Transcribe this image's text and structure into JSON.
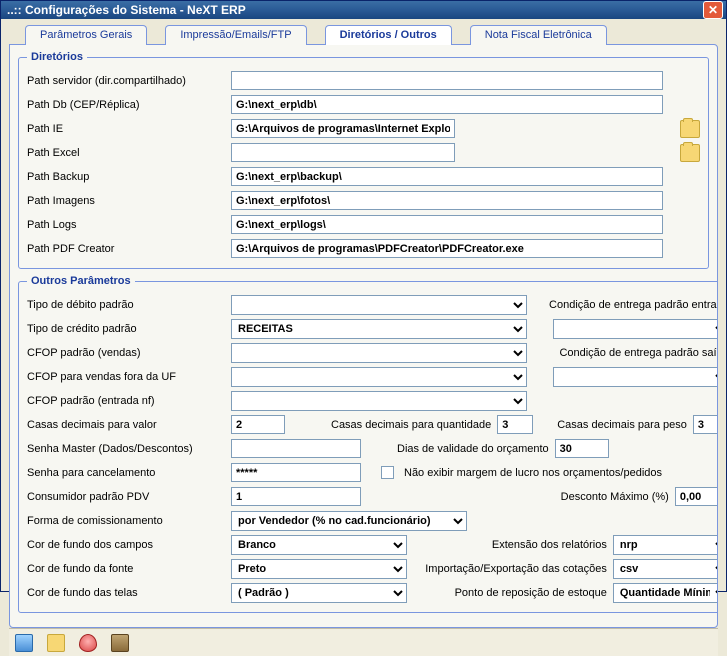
{
  "window": {
    "title": "..:: Configurações do Sistema - NeXT ERP"
  },
  "tabs": {
    "general": "Parâmetros Gerais",
    "print": "Impressão/Emails/FTP",
    "dirs": "Diretórios / Outros",
    "nfe": "Nota Fiscal Eletrônica"
  },
  "dir": {
    "legend": "Diretórios",
    "server_lbl": "Path servidor (dir.compartilhado)",
    "server_val": "",
    "db_lbl": "Path Db (CEP/Réplica)",
    "db_val": "G:\\next_erp\\db\\",
    "ie_lbl": "Path IE",
    "ie_val": "G:\\Arquivos de programas\\Internet Explorer\\iexplore.exe",
    "excel_lbl": "Path Excel",
    "excel_val": "",
    "backup_lbl": "Path Backup",
    "backup_val": "G:\\next_erp\\backup\\",
    "img_lbl": "Path Imagens",
    "img_val": "G:\\next_erp\\fotos\\",
    "logs_lbl": "Path Logs",
    "logs_val": "G:\\next_erp\\logs\\",
    "pdf_lbl": "Path PDF Creator",
    "pdf_val": "G:\\Arquivos de programas\\PDFCreator\\PDFCreator.exe"
  },
  "op": {
    "legend": "Outros Parâmetros",
    "tipo_deb_lbl": "Tipo de débito padrão",
    "tipo_cred_lbl": "Tipo de crédito padrão",
    "tipo_cred_val": "RECEITAS",
    "cfop_vendas_lbl": "CFOP padrão (vendas)",
    "cfop_fora_lbl": "CFOP para vendas fora da UF",
    "cfop_entrada_lbl": "CFOP padrão (entrada nf)",
    "cond_ent_in_lbl": "Condição de entrega padrão entrada",
    "cond_ent_out_lbl": "Condição de entrega padrão saída",
    "dec_val_lbl": "Casas decimais para valor",
    "dec_val": "2",
    "dec_qtd_lbl": "Casas decimais para quantidade",
    "dec_qtd": "3",
    "dec_peso_lbl": "Casas decimais para peso",
    "dec_peso": "3",
    "senha_master_lbl": "Senha Master (Dados/Descontos)",
    "senha_master_val": "",
    "dias_orc_lbl": "Dias de validade do orçamento",
    "dias_orc_val": "30",
    "senha_canc_lbl": "Senha para cancelamento",
    "senha_canc_val": "*****",
    "nao_margem_lbl": "Não exibir margem de lucro nos orçamentos/pedidos",
    "consumidor_lbl": "Consumidor padrão PDV",
    "consumidor_val": "1",
    "desc_max_lbl": "Desconto Máximo (%)",
    "desc_max_val": "0,00",
    "comiss_lbl": "Forma de comissionamento",
    "comiss_val": "por Vendedor (% no cad.funcionário)",
    "cor_campos_lbl": "Cor de fundo dos campos",
    "cor_campos_val": "Branco",
    "ext_rel_lbl": "Extensão dos relatórios",
    "ext_rel_val": "nrp",
    "cor_fonte_lbl": "Cor de fundo da fonte",
    "cor_fonte_val": "Preto",
    "imp_cot_lbl": "Importação/Exportação das cotações",
    "imp_cot_val": "csv",
    "cor_telas_lbl": "Cor de fundo das telas",
    "cor_telas_val": "( Padrão )",
    "repos_lbl": "Ponto de reposição de estoque",
    "repos_val": "Quantidade Mínima"
  }
}
